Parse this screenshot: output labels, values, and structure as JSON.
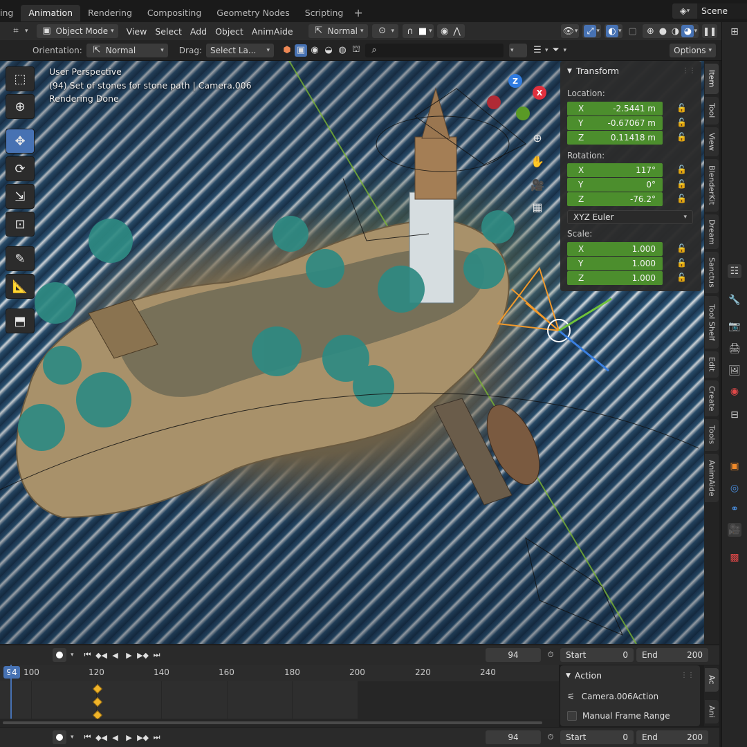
{
  "workspace_tabs": [
    "ing",
    "Animation",
    "Rendering",
    "Compositing",
    "Geometry Nodes",
    "Scripting"
  ],
  "active_tab": "Animation",
  "scene": {
    "label": "Scene"
  },
  "header": {
    "mode": "Object Mode",
    "menus": [
      "View",
      "Select",
      "Add",
      "Object",
      "AnimAide"
    ],
    "transform_orientation": "Normal"
  },
  "toolsettings": {
    "orientation_label": "Orientation:",
    "orientation_value": "Normal",
    "drag_label": "Drag:",
    "drag_value": "Select La...",
    "options_label": "Options"
  },
  "viewport_info": {
    "line1": "User Perspective",
    "line2": "(94) Set of stones for stone path | Camera.006",
    "line3": "Rendering Done"
  },
  "gizmo": {
    "z": "Z",
    "x": "X"
  },
  "transform_panel": {
    "title": "Transform",
    "location_label": "Location:",
    "location": [
      {
        "axis": "X",
        "value": "-2.5441 m"
      },
      {
        "axis": "Y",
        "value": "-0.67067 m"
      },
      {
        "axis": "Z",
        "value": "0.11418 m"
      }
    ],
    "rotation_label": "Rotation:",
    "rotation": [
      {
        "axis": "X",
        "value": "117°"
      },
      {
        "axis": "Y",
        "value": "0°"
      },
      {
        "axis": "Z",
        "value": "-76.2°"
      }
    ],
    "rotation_mode": "XYZ Euler",
    "scale_label": "Scale:",
    "scale": [
      {
        "axis": "X",
        "value": "1.000"
      },
      {
        "axis": "Y",
        "value": "1.000"
      },
      {
        "axis": "Z",
        "value": "1.000"
      }
    ]
  },
  "sidebar_tabs": [
    "Item",
    "Tool",
    "View",
    "BlenderKit",
    "Dream",
    "Sanctus",
    "Tool Shelf",
    "Edit",
    "Create",
    "Tools",
    "AnimAide"
  ],
  "timeline": {
    "current_frame": "94",
    "start_label": "Start",
    "start": "0",
    "end_label": "End",
    "end": "200",
    "ruler_labels": [
      "100",
      "120",
      "140",
      "160",
      "180",
      "200",
      "220",
      "240"
    ],
    "playhead": "94"
  },
  "action_panel": {
    "title": "Action",
    "action_name": "Camera.006Action",
    "manual_range_label": "Manual Frame Range",
    "tabs": [
      "Ac",
      "Ani"
    ]
  },
  "colors": {
    "accent": "#4772b3",
    "field_green": "#4c8e2d",
    "keyframe": "#f0b429",
    "gizmo_x": "#e0303e",
    "gizmo_y": "#6aa62a",
    "gizmo_z": "#2f7be0"
  }
}
